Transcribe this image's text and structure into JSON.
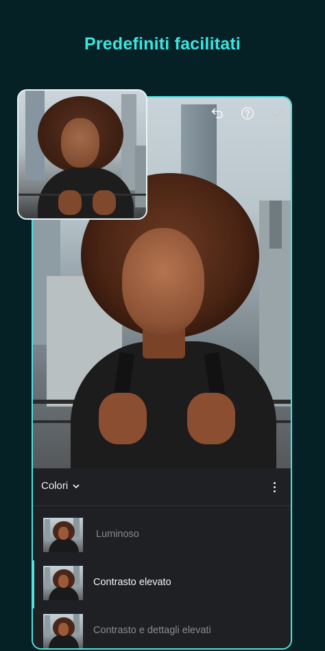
{
  "headline": "Predefiniti facilitati",
  "toolbar": {
    "undo_icon": "undo-icon",
    "help_icon": "help-icon",
    "confirm_icon": "checkmark-icon"
  },
  "panel": {
    "category_label": "Colori",
    "category_icon": "chevron-down-icon",
    "menu_icon": "more-vertical-icon",
    "presets": [
      {
        "label": "Luminoso",
        "selected": false
      },
      {
        "label": "Contrasto elevato",
        "selected": true
      },
      {
        "label": "Contrasto e dettagli elevati",
        "selected": false
      }
    ]
  },
  "colors": {
    "background": "#052126",
    "accent": "#39e6e0",
    "panel": "#1f2023"
  }
}
